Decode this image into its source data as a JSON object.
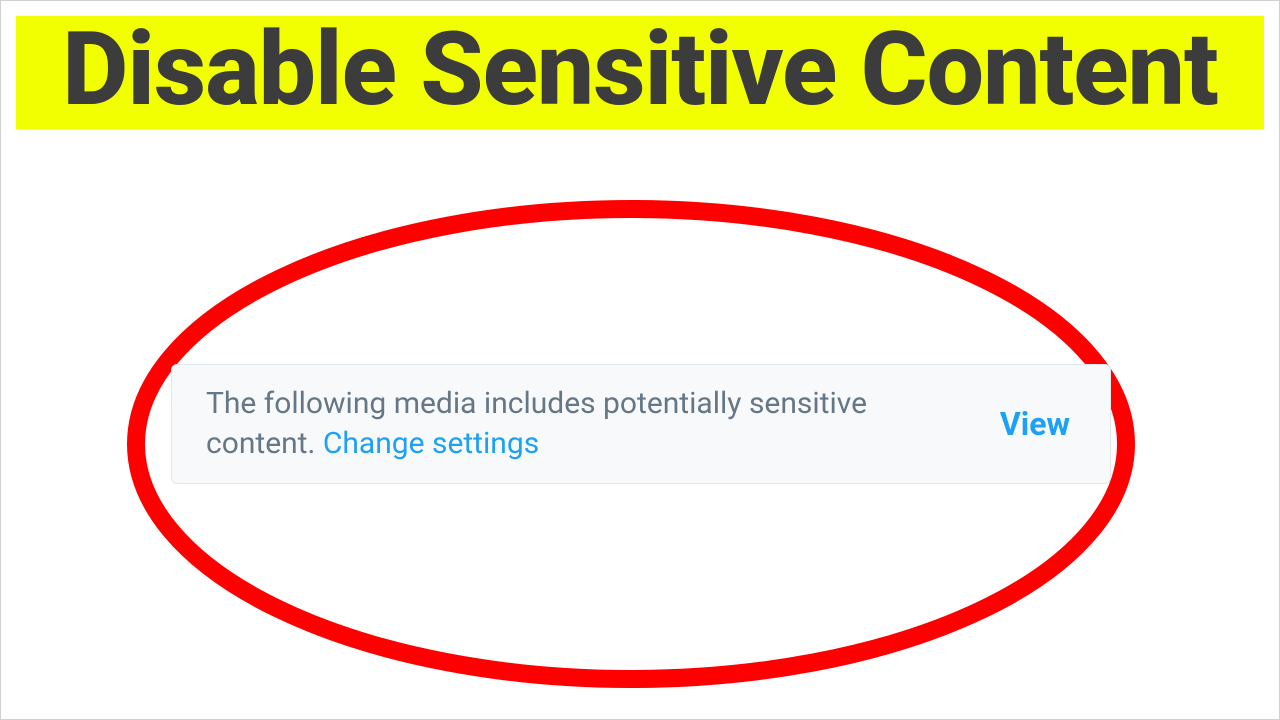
{
  "banner": {
    "title": "Disable Sensitive Content"
  },
  "warning": {
    "message": "The following media includes potentially sensitive content. ",
    "change_link": "Change settings",
    "view_label": "View"
  },
  "colors": {
    "highlight_stroke": "#ff0000",
    "banner_bg": "#f2ff00",
    "link": "#1da1f2"
  }
}
